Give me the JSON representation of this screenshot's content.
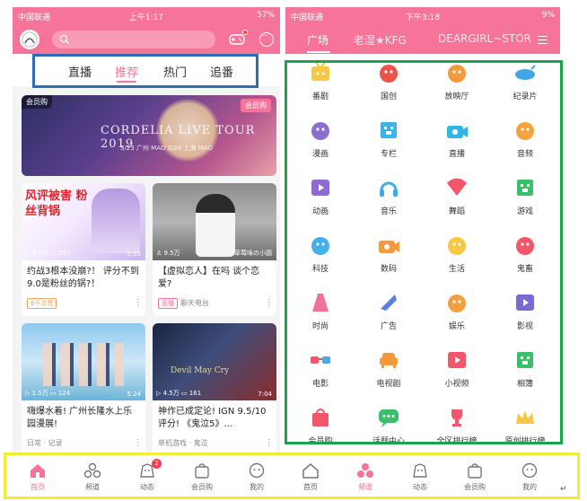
{
  "left_phone": {
    "status": {
      "carrier": "中国联通",
      "time": "上午1:17",
      "battery": "57%"
    },
    "tabs": [
      {
        "label": "直播"
      },
      {
        "label": "推荐"
      },
      {
        "label": "热门"
      },
      {
        "label": "追番"
      }
    ],
    "banner": {
      "tag": "会员购",
      "corner_tag": "会员购",
      "title": "CORDELIA LIVE TOUR 2019",
      "subtitle": "3/23 广州 MAO   3/24 上海 MAO"
    },
    "cards": [
      {
        "views": "4.7万",
        "comments": "327",
        "duration": "5:55",
        "thumb_text": "风评被害 粉丝背锅",
        "title": "约战3根本没崩?！ 评分不到9.0是粉丝的锅?！",
        "badge": "6千点赞",
        "source": ""
      },
      {
        "views": "9.5万",
        "comments": "",
        "duration": "草莓味の小圆",
        "thumb_text": "",
        "title": "【虚拟恋人】在吗  谈个恋爱?",
        "badge": "直播",
        "source": "聊天电台"
      },
      {
        "views": "1.5万",
        "comments": "124",
        "duration": "5:24",
        "thumb_text": "",
        "title": "嗨爆水着! 广州长隆水上乐园漫展!",
        "badge": "",
        "source": "日常 · 记录"
      },
      {
        "views": "4.5万",
        "comments": "161",
        "duration": "7:04",
        "thumb_text": "Devil May Cry",
        "title": "神作已成定论! IGN 9.5/10评分! 《鬼泣5》…",
        "badge": "",
        "source": "单机游戏 · 鬼泣"
      }
    ]
  },
  "right_phone": {
    "status": {
      "carrier": "中国联通",
      "time": "下午3:18",
      "battery": "9%"
    },
    "tabs": [
      {
        "label": "广场"
      },
      {
        "label": "老湿★KFG"
      },
      {
        "label": "DEARGIRL~STOR"
      }
    ],
    "categories": [
      {
        "label": "番剧",
        "color": "#f5c844"
      },
      {
        "label": "国创",
        "color": "#e8544a"
      },
      {
        "label": "放映厅",
        "color": "#f39a3c"
      },
      {
        "label": "纪录片",
        "color": "#3fa9e8"
      },
      {
        "label": "漫画",
        "color": "#8a6fd1"
      },
      {
        "label": "专栏",
        "color": "#3cb4e6"
      },
      {
        "label": "直播",
        "color": "#33b6e3"
      },
      {
        "label": "音频",
        "color": "#f3a33c"
      },
      {
        "label": "动画",
        "color": "#8d6ad6"
      },
      {
        "label": "音乐",
        "color": "#3fa9e8"
      },
      {
        "label": "舞蹈",
        "color": "#f2566b"
      },
      {
        "label": "游戏",
        "color": "#3cbf6a"
      },
      {
        "label": "科技",
        "color": "#43b1e8"
      },
      {
        "label": "数码",
        "color": "#f39a3c"
      },
      {
        "label": "生活",
        "color": "#f5c844"
      },
      {
        "label": "鬼畜",
        "color": "#f2566b"
      },
      {
        "label": "时尚",
        "color": "#f2739a"
      },
      {
        "label": "广告",
        "color": "#5b7fe0"
      },
      {
        "label": "娱乐",
        "color": "#f5a040"
      },
      {
        "label": "影视",
        "color": "#7a6ad6"
      },
      {
        "label": "电影",
        "color": "#f2566b"
      },
      {
        "label": "电视剧",
        "color": "#f39a3c"
      },
      {
        "label": "小视频",
        "color": "#f2566b"
      },
      {
        "label": "相簿",
        "color": "#3cbf6a"
      },
      {
        "label": "会员购",
        "color": "#f2566b"
      },
      {
        "label": "话题中心",
        "color": "#3cbf6a"
      },
      {
        "label": "全区排行榜",
        "color": "#f2566b"
      },
      {
        "label": "原创排行榜",
        "color": "#f5c844"
      }
    ]
  },
  "left_nav": [
    {
      "label": "首页"
    },
    {
      "label": "频道"
    },
    {
      "label": "动态",
      "badge": "2"
    },
    {
      "label": "会员购"
    },
    {
      "label": "我的"
    }
  ],
  "right_nav": [
    {
      "label": "首页"
    },
    {
      "label": "频道"
    },
    {
      "label": "动态"
    },
    {
      "label": "会员购"
    },
    {
      "label": "我的"
    }
  ],
  "colors": {
    "brand_pink": "#f6739a",
    "box_blue": "#2d6db5",
    "box_green": "#1aa54a",
    "box_yellow": "#f2ef33"
  }
}
